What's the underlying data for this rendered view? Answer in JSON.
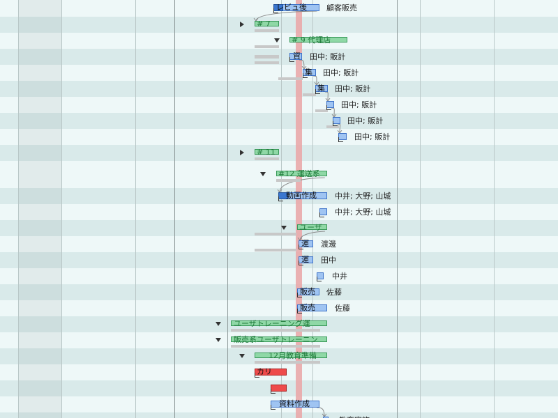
{
  "colors": {
    "row_light": "#eef8f8",
    "row_dark": "#d9eaea",
    "today_line": "#e9a9aa",
    "task_fill": "#9fc4f2",
    "task_border": "#3d72c8",
    "summary_fill": "#8fd8a6",
    "critical_fill": "#ee4b4b"
  },
  "rows": [
    {
      "bar": "レビュ後",
      "resource": "顧客販売"
    },
    {
      "bar": "# 7",
      "resource": "",
      "expander": "collapsed"
    },
    {
      "bar": "# 9 代理店",
      "resource": "",
      "expander": "expanded"
    },
    {
      "bar": "資",
      "resource": "田中; 販計"
    },
    {
      "bar": "集",
      "resource": "田中; 販計"
    },
    {
      "bar": "集",
      "resource": "田中; 販計"
    },
    {
      "bar": "",
      "resource": "田中; 販計"
    },
    {
      "bar": "",
      "resource": "田中; 販計"
    },
    {
      "bar": "",
      "resource": "田中; 販計"
    },
    {
      "bar": "# 11",
      "resource": "",
      "expander": "collapsed"
    },
    {
      "bar": "#12 運送系",
      "resource": "",
      "expander": "expanded"
    },
    {
      "bar": "動画作成",
      "resource": "中井; 大野; 山城"
    },
    {
      "bar": "",
      "resource": "中井; 大野; 山城"
    },
    {
      "bar": "ユーザ",
      "resource": "",
      "expander": "expanded"
    },
    {
      "bar": "運",
      "resource": "渡邊"
    },
    {
      "bar": "運",
      "resource": "田中"
    },
    {
      "bar": "",
      "resource": "中井"
    },
    {
      "bar": "販売",
      "resource": "佐藤"
    },
    {
      "bar": "販売",
      "resource": "佐藤"
    },
    {
      "bar": "ユーザトレーニング運",
      "resource": "",
      "expander": "expanded"
    },
    {
      "bar": "販売系ユーザトレーニン",
      "resource": "",
      "expander": "expanded"
    },
    {
      "bar": "12月教育準備",
      "resource": "",
      "expander": "expanded"
    },
    {
      "bar": "カリ",
      "resource": ""
    },
    {
      "bar": "",
      "resource": ""
    },
    {
      "bar": "資料作成",
      "resource": ""
    },
    {
      "bar": "",
      "resource": "教育実施"
    }
  ]
}
